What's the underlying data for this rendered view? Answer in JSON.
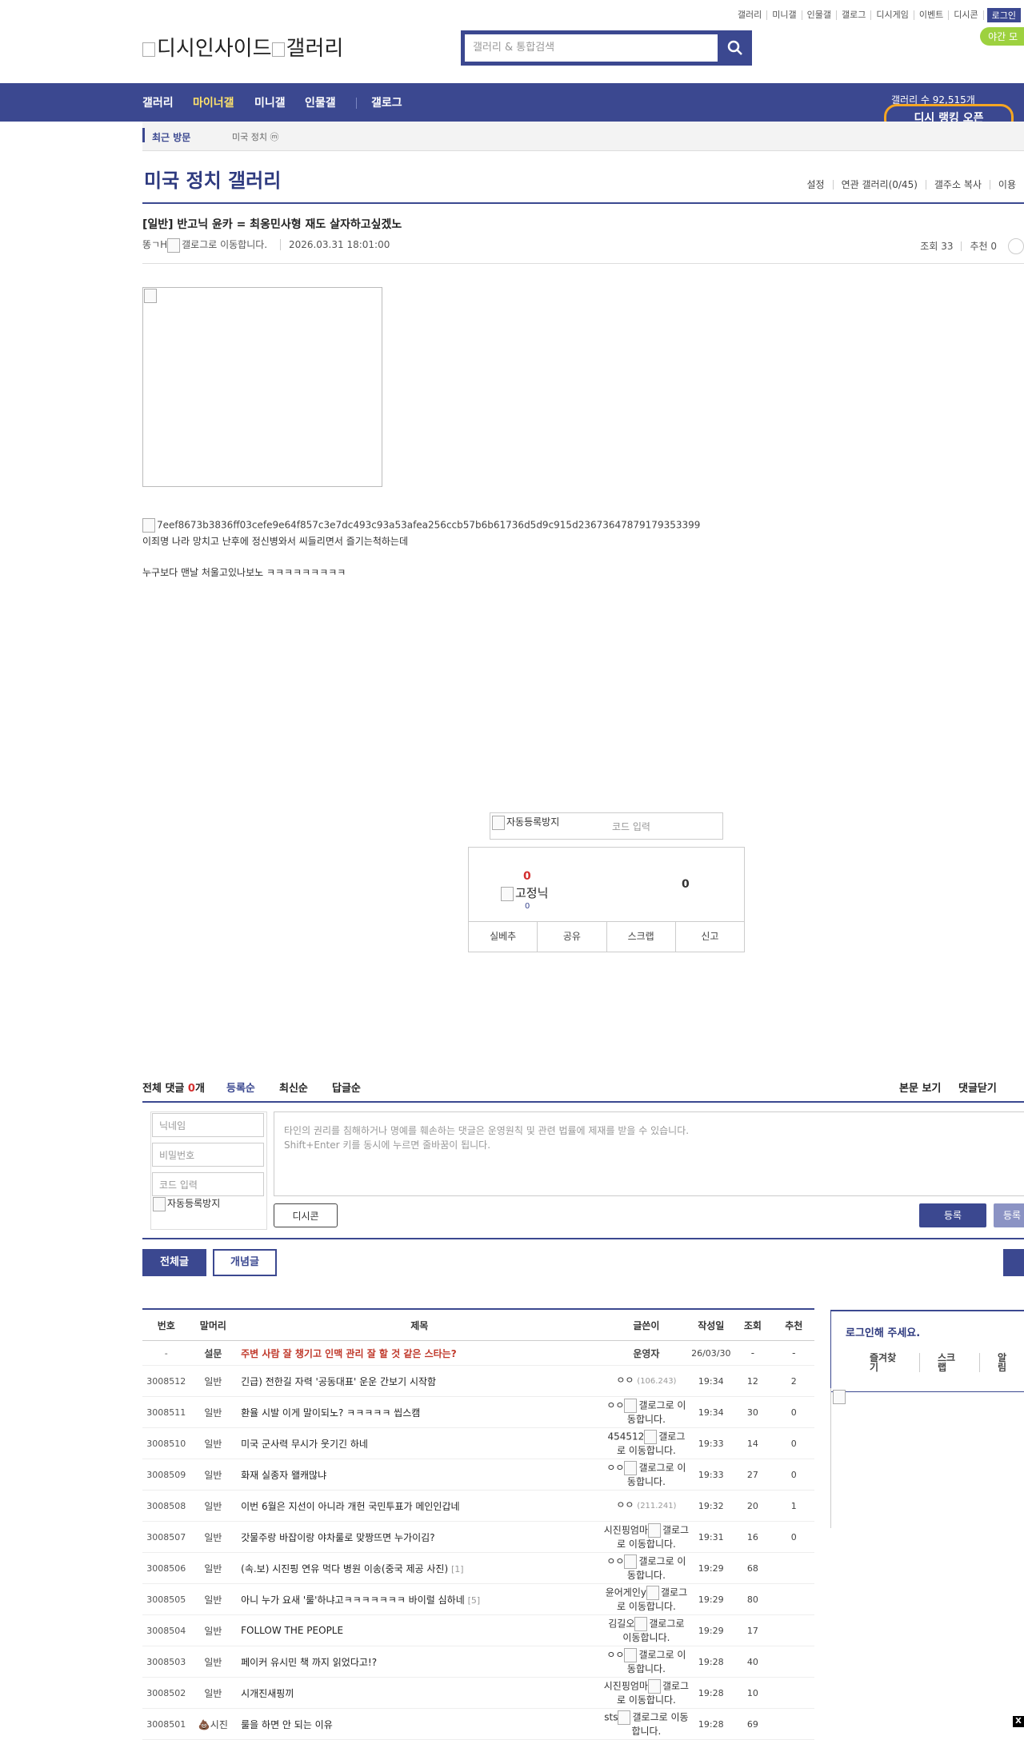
{
  "header": {
    "top_links": [
      "갤러리",
      "미니갤",
      "인물갤",
      "갤로그",
      "디시게임",
      "이벤트",
      "디시콘"
    ],
    "login": "로그인",
    "night_mode": "야간 모",
    "logo_alt": "디시인사이드",
    "logo_gallery_alt": "갤러리",
    "search_placeholder": "갤러리 & 통합검색"
  },
  "nav": {
    "items": [
      "갤러리",
      "마이너갤",
      "미니갤",
      "인물갤",
      "갤로그"
    ],
    "active_index": 1,
    "count_text": "갤러리 수 92,515개",
    "ranking": "디시 랭킹 오픈"
  },
  "recent": {
    "label": "최근 방문",
    "item": "미국 정치 ⓜ"
  },
  "gallery": {
    "title": "미국 정치 갤러리",
    "tools": [
      "설정",
      "연관 갤러리(0/45)",
      "갤주소 복사",
      "이용"
    ]
  },
  "post": {
    "title": "[일반] 반고닉 윤카 = 최옹민사형 재도 살자하고싶겠노",
    "author": "똥ㄱH",
    "author_icon_alt": "갤로그로 이동합니다.",
    "date": "2026.03.31 18:01:00",
    "views": "조회 33",
    "recommend": "추천 0",
    "image_alt": "7eef8673b3836ff03cefe9e64f857c3e7dc493c93a53afea256ccb57b6b61736d5d9c915d23673647879179353399",
    "line1": "이죄명 나라 망치고 난후에 정신병와서 씨들리면서 즐기는척하는데",
    "line2": "누구보다 맨날 처울고있나보노 ㅋㅋㅋㅋㅋㅋㅋㅋㅋ"
  },
  "vote": {
    "captcha_alt": "자동등록방지",
    "code_placeholder": "코드 입력",
    "up_count": "0",
    "fixed_label": "고정닉",
    "fixed_count": "0",
    "down_count": "0",
    "buttons": [
      "실베추",
      "공유",
      "스크랩",
      "신고"
    ]
  },
  "comments": {
    "label": "전체 댓글",
    "count": "0",
    "unit": "개",
    "sort": [
      "등록순",
      "최신순",
      "답글순"
    ],
    "right": [
      "본문 보기",
      "댓글닫기"
    ],
    "nickname_placeholder": "닉네임",
    "password_placeholder": "비밀번호",
    "code_placeholder": "코드 입력",
    "captcha_alt": "자동등록방지",
    "text_line1": "타인의 권리를 침해하거나 명예를 훼손하는 댓글은 운영원칙 및 관련 법률에 제재를 받을 수 있습니다.",
    "text_line2": "Shift+Enter 키를 동시에 누르면 줄바꿈이 됩니다.",
    "dccon": "디시콘",
    "submit": "등록",
    "submit2": "등록"
  },
  "list_tabs": {
    "all": "전체글",
    "concept": "개념글"
  },
  "table": {
    "headers": [
      "번호",
      "말머리",
      "제목",
      "글쓴이",
      "작성일",
      "조회",
      "추천"
    ],
    "notice": {
      "no": "-",
      "head": "설문",
      "title": "주변 사람 잘 챙기고 인맥 관리 잘 할 것 같은 스타는?",
      "writer": "운영자",
      "date": "26/03/30",
      "views": "-",
      "rec": "-"
    },
    "rows": [
      {
        "no": "3008512",
        "head": "일반",
        "title": "긴급) 전한길 자력 '공동대표' 운운 간보기 시작함",
        "rcnt": "",
        "writer": "ㅇㅇ",
        "ip": "(106.243)",
        "date": "19:34",
        "views": "12",
        "rec": "2"
      },
      {
        "no": "3008511",
        "head": "일반",
        "title": "환율 시발 이게 말이되노? ㅋㅋㅋㅋㅋ 씹스캠",
        "rcnt": "",
        "writer": "ㅇㅇ",
        "ip": "",
        "date": "19:34",
        "views": "30",
        "rec": "0"
      },
      {
        "no": "3008510",
        "head": "일반",
        "title": "미국 군사력 무시가 웃기긴 하네",
        "rcnt": "",
        "writer": "454512",
        "ip": "",
        "date": "19:33",
        "views": "14",
        "rec": "0"
      },
      {
        "no": "3008509",
        "head": "일반",
        "title": "화재 실종자 왤캐많냐",
        "rcnt": "",
        "writer": "ㅇㅇ",
        "ip": "",
        "date": "19:33",
        "views": "27",
        "rec": "0"
      },
      {
        "no": "3008508",
        "head": "일반",
        "title": "이번 6월은 지선이 아니라 개헌 국민투표가 메인인갑네",
        "rcnt": "",
        "writer": "ㅇㅇ",
        "ip": "(211.241)",
        "date": "19:32",
        "views": "20",
        "rec": "1"
      },
      {
        "no": "3008507",
        "head": "일반",
        "title": "갓물주랑 바잡이랑 야차룰로 맞짱뜨면 누가이김?",
        "rcnt": "",
        "writer": "시진핑엄마",
        "ip": "",
        "date": "19:31",
        "views": "16",
        "rec": "0"
      },
      {
        "no": "3008506",
        "head": "일반",
        "title": "(속.보) 시진핑 연유 먹다 병원 이송(중국 제공 사진)",
        "rcnt": "[1]",
        "writer": "ㅇㅇ",
        "ip": "",
        "date": "19:29",
        "views": "68",
        "rec": ""
      },
      {
        "no": "3008505",
        "head": "일반",
        "title": "아니 누가 요새 '룰'하냐고ㅋㅋㅋㅋㅋㅋㅋ 바이럴 심하네",
        "rcnt": "[5]",
        "writer": "윤어게인y",
        "ip": "",
        "date": "19:29",
        "views": "80",
        "rec": ""
      },
      {
        "no": "3008504",
        "head": "일반",
        "title": "FOLLOW THE PEOPLE",
        "rcnt": "",
        "writer": "김길오",
        "ip": "",
        "date": "19:29",
        "views": "17",
        "rec": ""
      },
      {
        "no": "3008503",
        "head": "일반",
        "title": "페이커 유시민 책 까지 읽었다고!?",
        "rcnt": "",
        "writer": "ㅇㅇ",
        "ip": "",
        "date": "19:28",
        "views": "40",
        "rec": ""
      },
      {
        "no": "3008502",
        "head": "일반",
        "title": "시개진새핑끼",
        "rcnt": "",
        "writer": "시진핑엄마",
        "ip": "",
        "date": "19:28",
        "views": "10",
        "rec": ""
      },
      {
        "no": "3008501",
        "head": "💩시진",
        "title": "룰을 하면 안 되는 이유",
        "rcnt": "",
        "writer": "sts",
        "ip": "",
        "date": "19:28",
        "views": "69",
        "rec": ""
      }
    ],
    "gallog_alt": "갤로그로 이동합니다."
  },
  "sidebar": {
    "login_prompt": "로그인해 주세요.",
    "links": [
      "즐겨찾기",
      "스크랩",
      "알림"
    ]
  },
  "colors": {
    "brand": "#3b4890",
    "accent": "#ffe36b",
    "night": "#9dd13f",
    "ranking_border": "#f5a623"
  }
}
